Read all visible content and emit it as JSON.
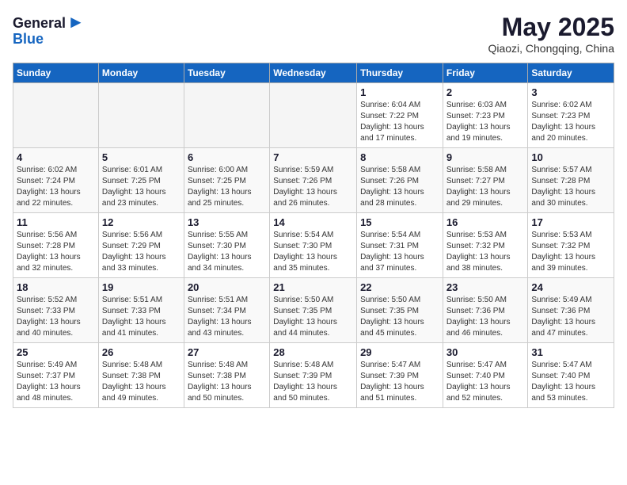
{
  "header": {
    "logo_line1": "General",
    "logo_line2": "Blue",
    "month_title": "May 2025",
    "location": "Qiaozi, Chongqing, China"
  },
  "days_of_week": [
    "Sunday",
    "Monday",
    "Tuesday",
    "Wednesday",
    "Thursday",
    "Friday",
    "Saturday"
  ],
  "weeks": [
    [
      {
        "day": "",
        "info": ""
      },
      {
        "day": "",
        "info": ""
      },
      {
        "day": "",
        "info": ""
      },
      {
        "day": "",
        "info": ""
      },
      {
        "day": "1",
        "info": "Sunrise: 6:04 AM\nSunset: 7:22 PM\nDaylight: 13 hours\nand 17 minutes."
      },
      {
        "day": "2",
        "info": "Sunrise: 6:03 AM\nSunset: 7:23 PM\nDaylight: 13 hours\nand 19 minutes."
      },
      {
        "day": "3",
        "info": "Sunrise: 6:02 AM\nSunset: 7:23 PM\nDaylight: 13 hours\nand 20 minutes."
      }
    ],
    [
      {
        "day": "4",
        "info": "Sunrise: 6:02 AM\nSunset: 7:24 PM\nDaylight: 13 hours\nand 22 minutes."
      },
      {
        "day": "5",
        "info": "Sunrise: 6:01 AM\nSunset: 7:25 PM\nDaylight: 13 hours\nand 23 minutes."
      },
      {
        "day": "6",
        "info": "Sunrise: 6:00 AM\nSunset: 7:25 PM\nDaylight: 13 hours\nand 25 minutes."
      },
      {
        "day": "7",
        "info": "Sunrise: 5:59 AM\nSunset: 7:26 PM\nDaylight: 13 hours\nand 26 minutes."
      },
      {
        "day": "8",
        "info": "Sunrise: 5:58 AM\nSunset: 7:26 PM\nDaylight: 13 hours\nand 28 minutes."
      },
      {
        "day": "9",
        "info": "Sunrise: 5:58 AM\nSunset: 7:27 PM\nDaylight: 13 hours\nand 29 minutes."
      },
      {
        "day": "10",
        "info": "Sunrise: 5:57 AM\nSunset: 7:28 PM\nDaylight: 13 hours\nand 30 minutes."
      }
    ],
    [
      {
        "day": "11",
        "info": "Sunrise: 5:56 AM\nSunset: 7:28 PM\nDaylight: 13 hours\nand 32 minutes."
      },
      {
        "day": "12",
        "info": "Sunrise: 5:56 AM\nSunset: 7:29 PM\nDaylight: 13 hours\nand 33 minutes."
      },
      {
        "day": "13",
        "info": "Sunrise: 5:55 AM\nSunset: 7:30 PM\nDaylight: 13 hours\nand 34 minutes."
      },
      {
        "day": "14",
        "info": "Sunrise: 5:54 AM\nSunset: 7:30 PM\nDaylight: 13 hours\nand 35 minutes."
      },
      {
        "day": "15",
        "info": "Sunrise: 5:54 AM\nSunset: 7:31 PM\nDaylight: 13 hours\nand 37 minutes."
      },
      {
        "day": "16",
        "info": "Sunrise: 5:53 AM\nSunset: 7:32 PM\nDaylight: 13 hours\nand 38 minutes."
      },
      {
        "day": "17",
        "info": "Sunrise: 5:53 AM\nSunset: 7:32 PM\nDaylight: 13 hours\nand 39 minutes."
      }
    ],
    [
      {
        "day": "18",
        "info": "Sunrise: 5:52 AM\nSunset: 7:33 PM\nDaylight: 13 hours\nand 40 minutes."
      },
      {
        "day": "19",
        "info": "Sunrise: 5:51 AM\nSunset: 7:33 PM\nDaylight: 13 hours\nand 41 minutes."
      },
      {
        "day": "20",
        "info": "Sunrise: 5:51 AM\nSunset: 7:34 PM\nDaylight: 13 hours\nand 43 minutes."
      },
      {
        "day": "21",
        "info": "Sunrise: 5:50 AM\nSunset: 7:35 PM\nDaylight: 13 hours\nand 44 minutes."
      },
      {
        "day": "22",
        "info": "Sunrise: 5:50 AM\nSunset: 7:35 PM\nDaylight: 13 hours\nand 45 minutes."
      },
      {
        "day": "23",
        "info": "Sunrise: 5:50 AM\nSunset: 7:36 PM\nDaylight: 13 hours\nand 46 minutes."
      },
      {
        "day": "24",
        "info": "Sunrise: 5:49 AM\nSunset: 7:36 PM\nDaylight: 13 hours\nand 47 minutes."
      }
    ],
    [
      {
        "day": "25",
        "info": "Sunrise: 5:49 AM\nSunset: 7:37 PM\nDaylight: 13 hours\nand 48 minutes."
      },
      {
        "day": "26",
        "info": "Sunrise: 5:48 AM\nSunset: 7:38 PM\nDaylight: 13 hours\nand 49 minutes."
      },
      {
        "day": "27",
        "info": "Sunrise: 5:48 AM\nSunset: 7:38 PM\nDaylight: 13 hours\nand 50 minutes."
      },
      {
        "day": "28",
        "info": "Sunrise: 5:48 AM\nSunset: 7:39 PM\nDaylight: 13 hours\nand 50 minutes."
      },
      {
        "day": "29",
        "info": "Sunrise: 5:47 AM\nSunset: 7:39 PM\nDaylight: 13 hours\nand 51 minutes."
      },
      {
        "day": "30",
        "info": "Sunrise: 5:47 AM\nSunset: 7:40 PM\nDaylight: 13 hours\nand 52 minutes."
      },
      {
        "day": "31",
        "info": "Sunrise: 5:47 AM\nSunset: 7:40 PM\nDaylight: 13 hours\nand 53 minutes."
      }
    ]
  ]
}
